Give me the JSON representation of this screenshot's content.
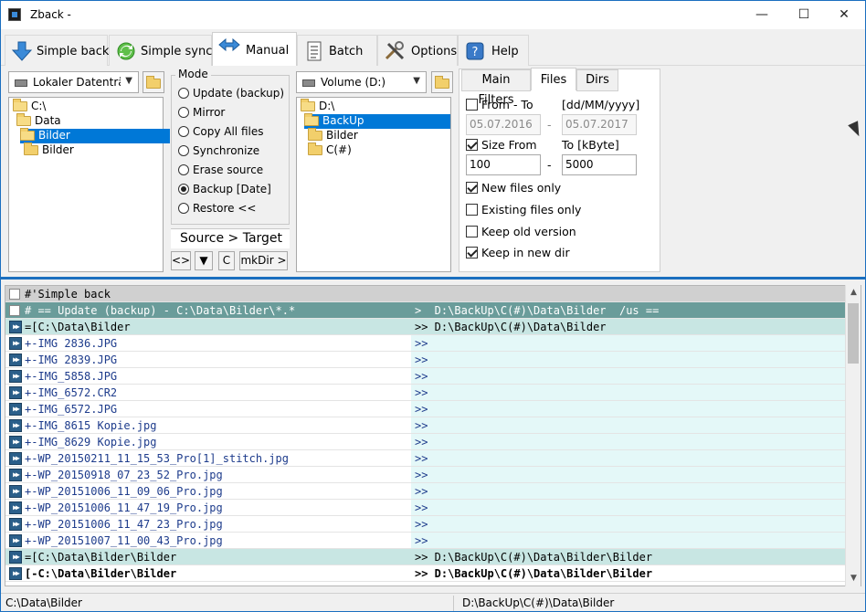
{
  "window": {
    "title": "Zback -",
    "controls": {
      "minimize": "—",
      "maximize": "☐",
      "close": "✕"
    }
  },
  "toolbar": {
    "tabs": [
      {
        "label": "Simple back",
        "icon": "down-arrow-icon"
      },
      {
        "label": "Simple sync",
        "icon": "sync-icon"
      },
      {
        "label": "Manual",
        "icon": "left-right-arrows-icon",
        "active": true
      },
      {
        "label": "Batch",
        "icon": "document-icon"
      },
      {
        "label": "Options",
        "icon": "tools-icon"
      },
      {
        "label": "Help",
        "icon": "help-icon"
      }
    ]
  },
  "source": {
    "drive": "Lokaler Datenträger",
    "tree": [
      "C:\\",
      "Data",
      "Bilder",
      "Bilder"
    ],
    "selected": "Bilder"
  },
  "mode": {
    "legend": "Mode",
    "options": [
      "Update (backup)",
      "Mirror",
      "Copy All files",
      "Synchronize",
      "Erase source",
      "Backup [Date]",
      "Restore <<"
    ],
    "selected": "Backup [Date]",
    "source_target": "Source > Target",
    "buttons": [
      "<>",
      "▼",
      "C",
      "mkDir >"
    ]
  },
  "target": {
    "drive": "Volume (D:)",
    "tree": [
      "D:\\",
      "BackUp",
      "Bilder",
      "C(#)"
    ],
    "selected": "BackUp"
  },
  "filters": {
    "tabs": [
      "Main Filters",
      "Files",
      "Dirs"
    ],
    "active_tab": "Files",
    "from_to_label": "From  - To",
    "date_format_label": "[dd/MM/yyyy]",
    "date_from": "05.07.2016",
    "date_to": "05.07.2017",
    "dash": "-",
    "size_from_label": "Size  From",
    "size_to_label": "To [kByte]",
    "size_from": "100",
    "size_to": "5000",
    "checks": {
      "from_to": false,
      "size": true,
      "new_files_only": true,
      "existing_files_only": false,
      "keep_old_version": false,
      "keep_in_new_dir": true
    },
    "labels": {
      "new_files_only": "New files only",
      "existing_files_only": "Existing files only",
      "keep_old_version": "Keep old version",
      "keep_in_new_dir": "Keep in new dir"
    }
  },
  "grid": {
    "rows": [
      {
        "kind": "hdr-gray",
        "marker": "check",
        "left": "#'Simple back",
        "right": ""
      },
      {
        "kind": "hdr-dark",
        "marker": "check",
        "left": "# == Update (backup) - C:\\Data\\Bilder\\*.*",
        "right": ">  D:\\BackUp\\C(#)\\Data\\Bilder  /us =="
      },
      {
        "kind": "dir-row",
        "marker": "ffw",
        "left": "=[C:\\Data\\Bilder",
        "right": ">> D:\\BackUp\\C(#)\\Data\\Bilder"
      },
      {
        "kind": "file",
        "marker": "ffw",
        "left": "+-IMG 2836.JPG",
        "right": ">>"
      },
      {
        "kind": "file",
        "marker": "ffw",
        "left": "+-IMG 2839.JPG",
        "right": ">>"
      },
      {
        "kind": "file",
        "marker": "ffw",
        "left": "+-IMG_5858.JPG",
        "right": ">>"
      },
      {
        "kind": "file",
        "marker": "ffw",
        "left": "+-IMG_6572.CR2",
        "right": ">>"
      },
      {
        "kind": "file",
        "marker": "ffw",
        "left": "+-IMG_6572.JPG",
        "right": ">>"
      },
      {
        "kind": "file",
        "marker": "ffw",
        "left": "+-IMG_8615 Kopie.jpg",
        "right": ">>"
      },
      {
        "kind": "file",
        "marker": "ffw",
        "left": "+-IMG_8629 Kopie.jpg",
        "right": ">>"
      },
      {
        "kind": "file",
        "marker": "ffw",
        "left": "+-WP_20150211_11_15_53_Pro[1]_stitch.jpg",
        "right": ">>"
      },
      {
        "kind": "file",
        "marker": "ffw",
        "left": "+-WP_20150918_07_23_52_Pro.jpg",
        "right": ">>"
      },
      {
        "kind": "file",
        "marker": "ffw",
        "left": "+-WP_20151006_11_09_06_Pro.jpg",
        "right": ">>"
      },
      {
        "kind": "file",
        "marker": "ffw",
        "left": "+-WP_20151006_11_47_19_Pro.jpg",
        "right": ">>"
      },
      {
        "kind": "file",
        "marker": "ffw",
        "left": "+-WP_20151006_11_47_23_Pro.jpg",
        "right": ">>"
      },
      {
        "kind": "file",
        "marker": "ffw",
        "left": "+-WP_20151007_11_00_43_Pro.jpg",
        "right": ">>"
      },
      {
        "kind": "dir-row",
        "marker": "ffw",
        "left": "=[C:\\Data\\Bilder\\Bilder",
        "right": ">> D:\\BackUp\\C(#)\\Data\\Bilder\\Bilder"
      },
      {
        "kind": "bold",
        "marker": "ffw",
        "left": "[-C:\\Data\\Bilder\\Bilder",
        "right": ">> D:\\BackUp\\C(#)\\Data\\Bilder\\Bilder"
      }
    ]
  },
  "statusbar": {
    "left": "C:\\Data\\Bilder",
    "right": "D:\\BackUp\\C(#)\\Data\\Bilder"
  },
  "colors": {
    "accent": "#1b6fbf",
    "selection": "#0078d7",
    "header_dark": "#6a9c9a",
    "dir_row": "#c8e6e3",
    "file_text": "#1e3c8c"
  }
}
